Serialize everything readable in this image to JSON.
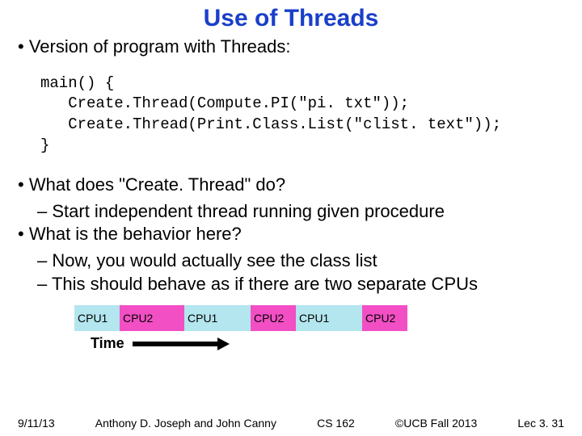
{
  "title": "Use of Threads",
  "bullets": {
    "b1": "Version of program with Threads:",
    "b2": "What does \"Create. Thread\" do?",
    "b2a": "Start independent thread running given procedure",
    "b3": "What is the behavior here?",
    "b3a": "Now, you would actually see the class list",
    "b3b": "This should behave as if there are two separate CPUs"
  },
  "code": {
    "l1": "main() {",
    "l2": "   Create.Thread(Compute.PI(\"pi. txt\"));",
    "l3": "   Create.Thread(Print.Class.List(\"clist. text\"));",
    "l4": "}"
  },
  "cpu": {
    "c1": "CPU1",
    "c2": "CPU2",
    "c3": "CPU1",
    "c4": "CPU2",
    "c5": "CPU1",
    "c6": "CPU2"
  },
  "time_label": "Time",
  "footer": {
    "date": "9/11/13",
    "authors": "Anthony D. Joseph and John Canny",
    "course": "CS 162",
    "copyright": "©UCB Fall 2013",
    "lec": "Lec 3. 31"
  }
}
